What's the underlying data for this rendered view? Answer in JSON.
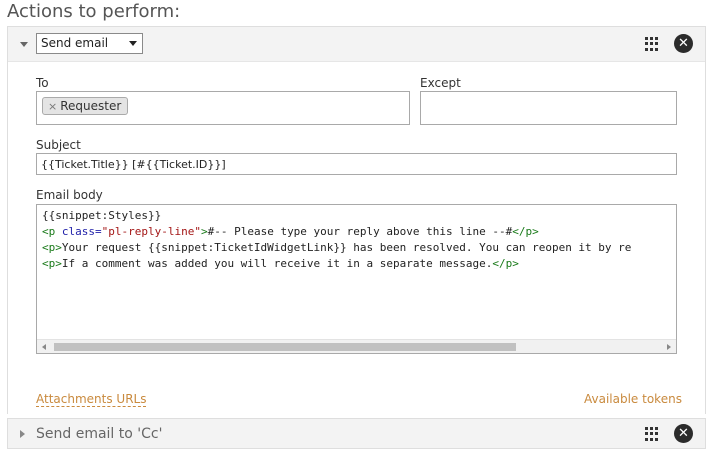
{
  "section_title": "Actions to perform:",
  "action1": {
    "type_value": "Send email",
    "to_label": "To",
    "to_chips": [
      "Requester"
    ],
    "except_label": "Except",
    "subject_label": "Subject",
    "subject_value": "{{Ticket.Title}} [#{{Ticket.ID}}]",
    "body_label": "Email body",
    "body_lines": {
      "l1": "{{snippet:Styles}}",
      "l2_tag_open": "<p ",
      "l2_attr": "class=",
      "l2_val": "\"pl-reply-line\"",
      "l2_gt": ">",
      "l2_text": "#-- Please type your reply above this line --#",
      "l2_close": "</p>",
      "l3_open": "<p>",
      "l3_text": "Your request {{snippet:TicketIdWidgetLink}} has been resolved. You can reopen it by re",
      "l4_open": "<p>",
      "l4_text": "If a comment was added you will receive it in a separate message.",
      "l4_close": "</p>"
    },
    "attachments_link": "Attachments URLs",
    "tokens_link": "Available tokens"
  },
  "action2": {
    "title": "Send email to 'Cc'"
  },
  "icons": {
    "drag": "drag-handle-icon",
    "remove": "close-circle-icon"
  },
  "colors": {
    "link": "#c98a3e",
    "tag": "#1a7a1a",
    "attr": "#1e1ea8",
    "attr_value": "#a31515"
  }
}
